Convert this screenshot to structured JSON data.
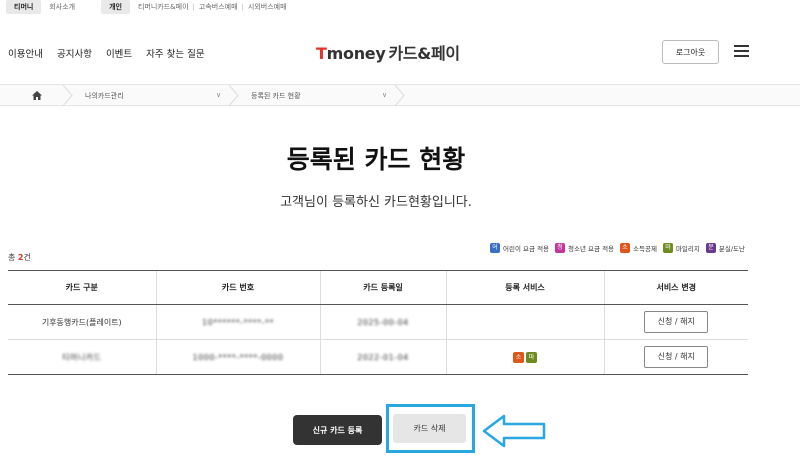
{
  "topbar": {
    "tmoney": "티머니",
    "company": "회사소개",
    "personal": "개인",
    "links": [
      "티머니카드&페이",
      "고속버스예매",
      "시외버스예매"
    ]
  },
  "header": {
    "nav": [
      "이용안내",
      "공지사항",
      "이벤트",
      "자주 찾는 질문"
    ],
    "logo_t": "T",
    "logo_rest": "money",
    "logo_kr": "카드&페이",
    "logout": "로그아웃"
  },
  "breadcrumb": {
    "item1": "나의카드관리",
    "item2": "등록된 카드 현황"
  },
  "main": {
    "title": "등록된 카드 현황",
    "subtitle": "고객님이 등록하신 카드현황입니다.",
    "total_prefix": "총 ",
    "total_count": "2",
    "total_suffix": "건"
  },
  "legend": [
    {
      "badge": "어",
      "label": "어린이 요금 적용",
      "color": "#3b6fc4"
    },
    {
      "badge": "청",
      "label": "청소년 요금 적용",
      "color": "#c2359a"
    },
    {
      "badge": "소",
      "label": "소득공제",
      "color": "#e0561a"
    },
    {
      "badge": "마",
      "label": "마일리지",
      "color": "#6e8b1f"
    },
    {
      "badge": "분",
      "label": "분실/도난",
      "color": "#6a3a8a"
    }
  ],
  "table": {
    "headers": [
      "카드 구분",
      "카드 번호",
      "카드 등록일",
      "등록 서비스",
      "서비스 변경"
    ],
    "rows": [
      {
        "type": "기후동행카드(플레이트)",
        "number": "10******-****-**",
        "date": "2025-00-04",
        "services": [],
        "change": "신청 / 해지"
      },
      {
        "type": "티머니카드",
        "number": "1000-****-****-0000",
        "date": "2022-01-04",
        "services": [
          {
            "badge": "소",
            "color": "#e0561a"
          },
          {
            "badge": "마",
            "color": "#6e8b1f"
          }
        ],
        "change": "신청 / 해지"
      }
    ]
  },
  "actions": {
    "new_card": "신규 카드 등록",
    "delete_card": "카드 삭제"
  },
  "colors": {
    "accent": "#e6332a",
    "highlight": "#29a7e1"
  }
}
